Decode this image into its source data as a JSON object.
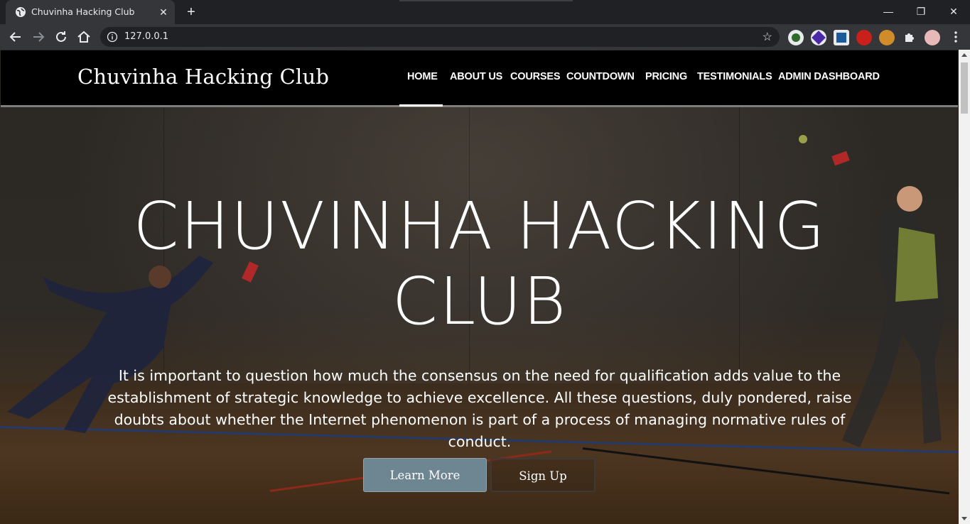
{
  "browser": {
    "tab_title": "Chuvinha Hacking Club",
    "tab_close": "✕",
    "new_tab": "+",
    "url": "127.0.0.1",
    "window_controls": {
      "minimize": "—",
      "maximize": "❐",
      "close": "✕"
    }
  },
  "nav": {
    "brand": "Chuvinha Hacking Club",
    "links": [
      {
        "label": "HOME",
        "active": true
      },
      {
        "label": "ABOUT US",
        "active": false
      },
      {
        "label": "COURSES",
        "active": false
      },
      {
        "label": "COUNTDOWN",
        "active": false
      },
      {
        "label": "PRICING",
        "active": false
      },
      {
        "label": "TESTIMONIALS",
        "active": false
      },
      {
        "label": "ADMIN DASHBOARD",
        "active": false
      }
    ]
  },
  "hero": {
    "title_line1": "CHUVINHA HACKING",
    "title_line2": "CLUB",
    "text": "It is important to question how much the consensus on the need for qualification adds value to the establishment of strategic knowledge to achieve excellence. All these questions, duly pondered, raise doubts about whether the Internet phenomenon is part of a process of managing normative rules of conduct.",
    "learn_more": "Learn More",
    "sign_up": "Sign Up"
  },
  "colors": {
    "nav_bg": "#000000",
    "primary_button": "#6e8592",
    "browser_bg": "#202124",
    "toolbar_bg": "#35363a"
  },
  "icons": {
    "tab_favicon": "globe-icon",
    "back": "arrow-left-icon",
    "forward": "arrow-right-icon",
    "reload": "reload-icon",
    "home": "home-icon",
    "site_info": "info-icon",
    "bookmark": "star-icon",
    "extensions": "puzzle-icon",
    "menu": "kebab-menu-icon"
  }
}
